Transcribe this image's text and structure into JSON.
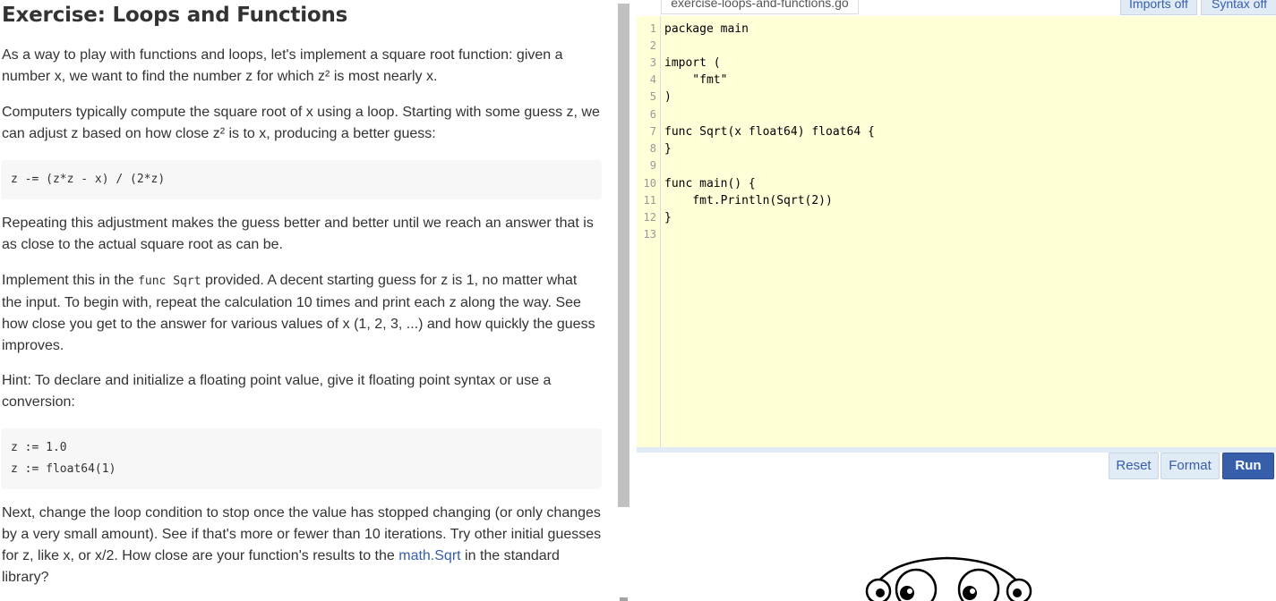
{
  "lesson": {
    "title": "Exercise: Loops and Functions",
    "p1_line1": "As a way to play with functions and loops, let's implement a square root function: given a",
    "p1_line2": "number x, we want to find the number z for which z² is most nearly x.",
    "p2_line1": "Computers typically compute the square root of x using a loop. Starting with some guess z, we",
    "p2_line2": "can adjust z based on how close z² is to x, producing a better guess:",
    "code1": "z -= (z*z - x) / (2*z)",
    "p3_line1": "Repeating this adjustment makes the guess better and better until we reach an answer that is",
    "p3_line2": "as close to the actual square root as can be.",
    "p4_line1_pre": "Implement this in the ",
    "p4_line1_code": "func Sqrt",
    "p4_line1_post": " provided. A decent starting guess for z is 1, no matter what",
    "p4_line2": "the input. To begin with, repeat the calculation 10 times and print each z along the way. See",
    "p4_line3": "how close you get to the answer for various values of x (1, 2, 3, ...) and how quickly the guess",
    "p4_line4": "improves.",
    "p5_line1": "Hint: To declare and initialize a floating point value, give it floating point syntax or use a",
    "p5_line2": "conversion:",
    "code2_line1": "z := 1.0",
    "code2_line2": "z := float64(1)",
    "p6_line1": "Next, change the loop condition to stop once the value has stopped changing (or only changes",
    "p6_line2": "by a very small amount). See if that's more or fewer than 10 iterations. Try other initial guesses",
    "p6_line3_pre": "for z, like x, or x/2. How close are your function's results to the ",
    "p6_line3_link": "math.Sqrt",
    "p6_line3_post": " in the standard",
    "p6_line4": "library?"
  },
  "editor": {
    "filename": "exercise-loops-and-functions.go",
    "imports_btn": "Imports off",
    "syntax_btn": "Syntax off",
    "line_numbers": [
      "1",
      "2",
      "3",
      "4",
      "5",
      "6",
      "7",
      "8",
      "9",
      "10",
      "11",
      "12",
      "13"
    ],
    "lines": [
      "package main",
      "",
      "import (",
      "    \"fmt\"",
      ")",
      "",
      "func Sqrt(x float64) float64 {",
      "}",
      "",
      "func main() {",
      "    fmt.Println(Sqrt(2))",
      "}",
      ""
    ]
  },
  "controls": {
    "reset": "Reset",
    "format": "Format",
    "run": "Run"
  },
  "colors": {
    "editor_bg": "#ffffd8",
    "accent": "#375eab",
    "button_bg": "#e0ebf5"
  }
}
